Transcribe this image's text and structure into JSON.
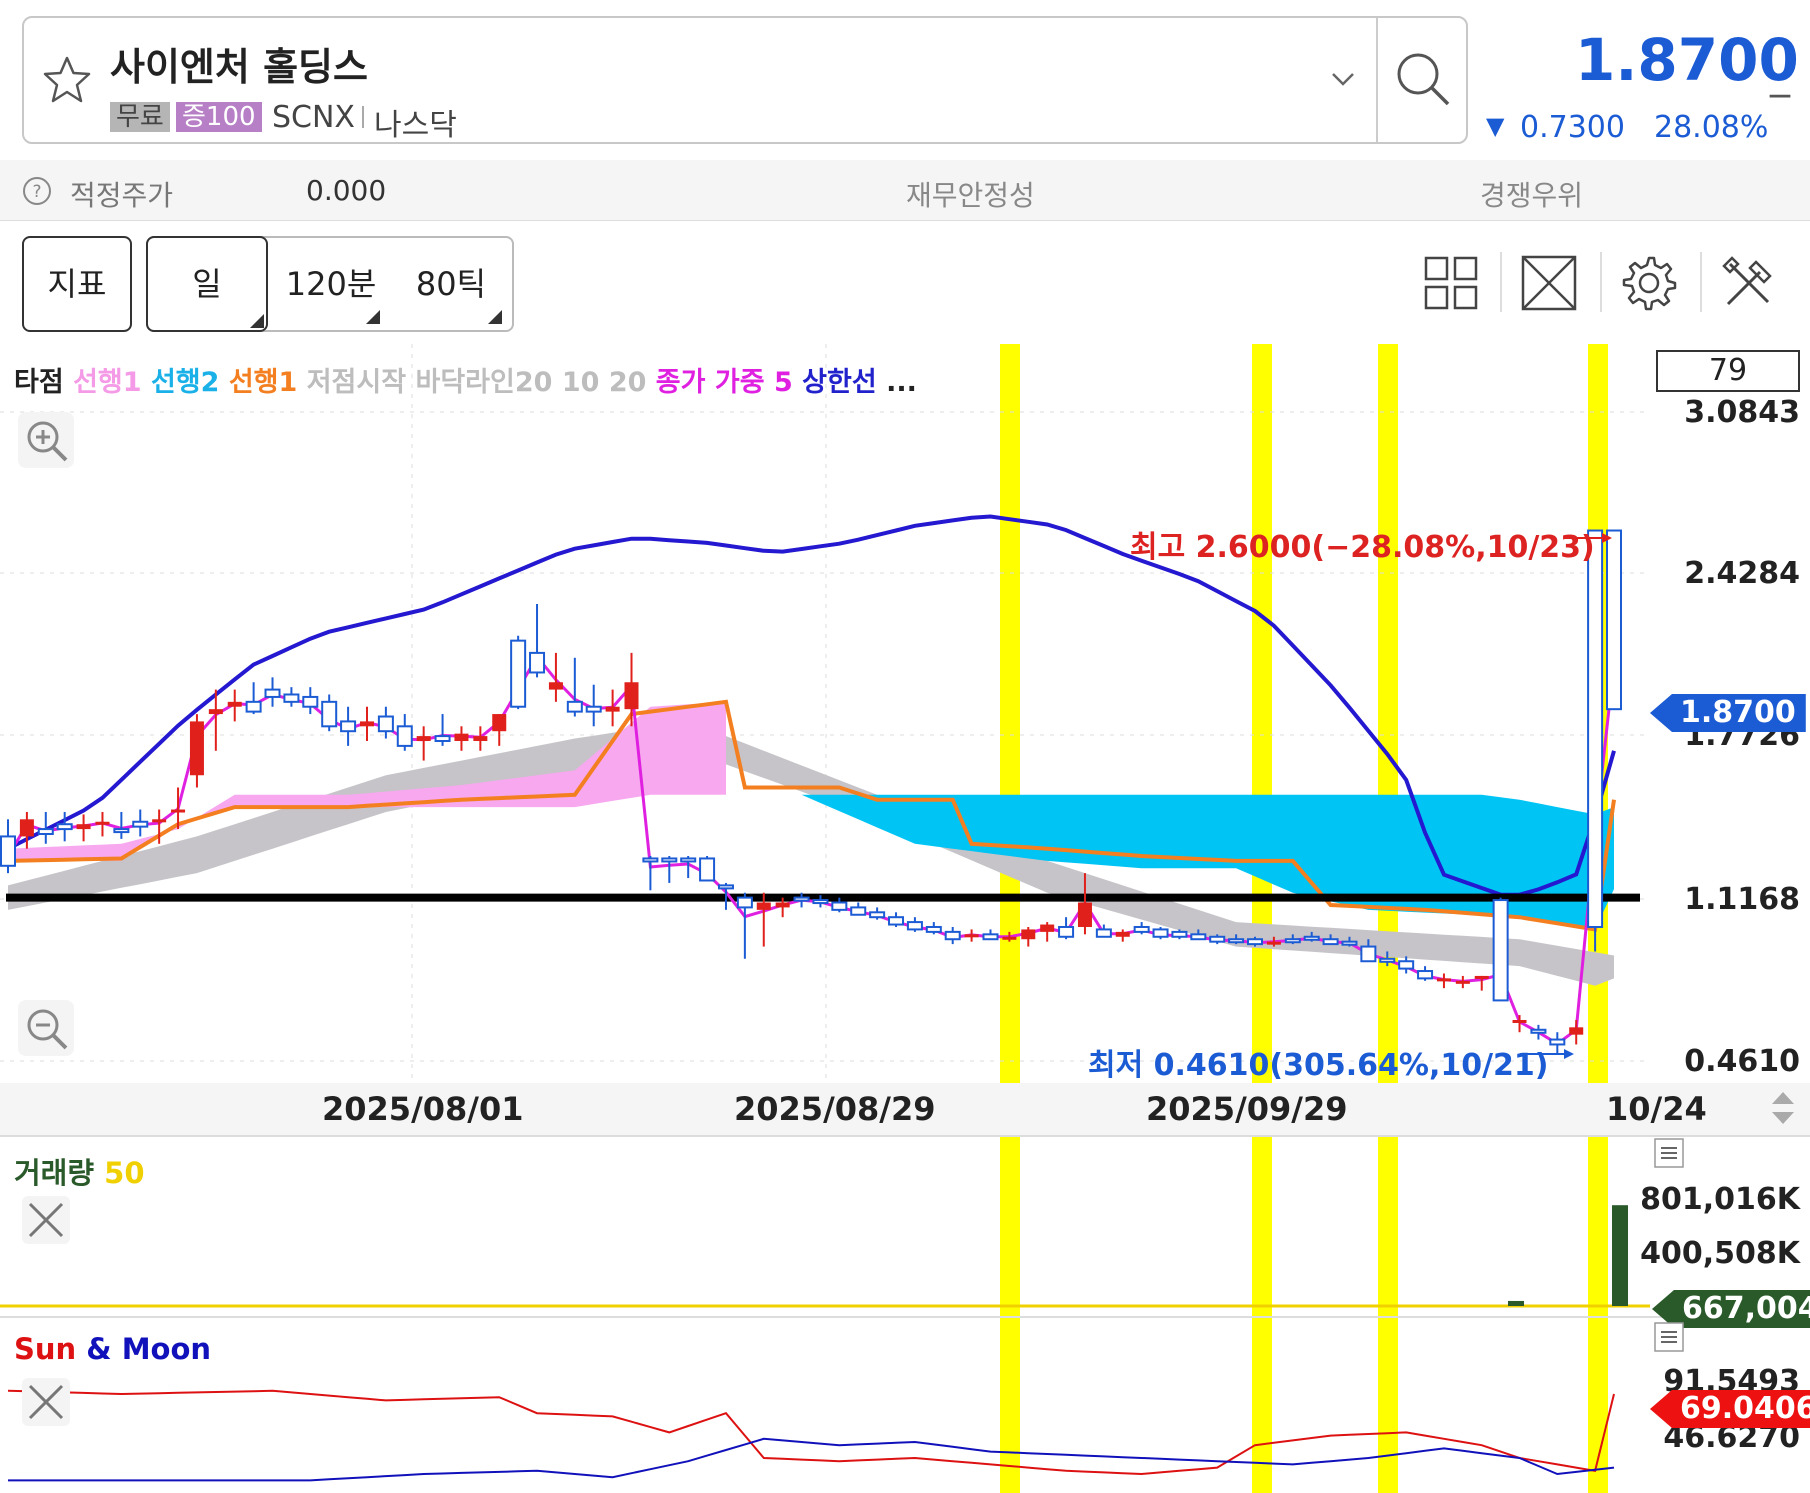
{
  "header": {
    "name": "사이엔처 홀딩스",
    "badge_free": "무료",
    "badge_margin": "증100",
    "ticker": "SCNX",
    "exchange": "나스닥",
    "price": "1.8700",
    "price_suffix": "_",
    "change_arrow": "▼",
    "change": "0.7300",
    "change_pct": "28.08%",
    "price_color": "#1b5bd4"
  },
  "info_row": {
    "fair_price_label": "적정주가",
    "fair_price_value": "0.000",
    "financial_stability_label": "재무안정성",
    "competitive_advantage_label": "경쟁우위"
  },
  "toolbar": {
    "indicator_label": "지표",
    "periods": [
      "일",
      "120분",
      "80틱"
    ],
    "tool_icons": [
      "grid-layout-icon",
      "fullscreen-icon",
      "gear-icon",
      "tools-icon"
    ]
  },
  "legend": {
    "items": [
      {
        "text": "타점",
        "color": "#222222"
      },
      {
        "text": "선행1",
        "color": "#f49ae6"
      },
      {
        "text": "선행2",
        "color": "#1ab0e8"
      },
      {
        "text": "선행1",
        "color": "#f47f20"
      },
      {
        "text": "저점시작",
        "color": "#bdbdbd"
      },
      {
        "text": "바닥라인20",
        "color": "#bdbdbd"
      },
      {
        "text": "10",
        "color": "#bdbdbd"
      },
      {
        "text": "20",
        "color": "#bdbdbd"
      },
      {
        "text": "종가",
        "color": "#e020e0"
      },
      {
        "text": "가중",
        "color": "#e020e0"
      },
      {
        "text": "5",
        "color": "#e020e0"
      },
      {
        "text": "상한선",
        "color": "#2222cc"
      },
      {
        "text": "...",
        "color": "#222222"
      }
    ],
    "period_box": "79"
  },
  "chart_data": [
    {
      "type": "candlestick",
      "title": "",
      "y_axis_ticks": [
        "3.0843",
        "2.4284",
        "1.7726",
        "1.1168",
        "0.4610"
      ],
      "ylim": [
        0.461,
        3.0843
      ],
      "x_axis_ticks": [
        "2025/08/01",
        "2025/08/29",
        "2025/09/29",
        "10/24"
      ],
      "current_price_tag": "1.8700",
      "high_annotation": "최고 2.6000(−28.08%,10/23)",
      "low_annotation": "최저 0.4610(305.64%,10/21)",
      "horizontal_line": 1.1,
      "candles": [
        [
          1.35,
          1.42,
          1.2,
          1.23
        ],
        [
          1.35,
          1.45,
          1.3,
          1.42
        ],
        [
          1.38,
          1.45,
          1.32,
          1.36
        ],
        [
          1.4,
          1.45,
          1.33,
          1.38
        ],
        [
          1.38,
          1.44,
          1.33,
          1.4
        ],
        [
          1.4,
          1.45,
          1.35,
          1.41
        ],
        [
          1.38,
          1.45,
          1.34,
          1.37
        ],
        [
          1.41,
          1.46,
          1.35,
          1.39
        ],
        [
          1.41,
          1.46,
          1.32,
          1.42
        ],
        [
          1.45,
          1.55,
          1.38,
          1.46
        ],
        [
          1.6,
          1.85,
          1.55,
          1.82
        ],
        [
          1.85,
          1.95,
          1.7,
          1.87
        ],
        [
          1.88,
          1.95,
          1.82,
          1.9
        ],
        [
          1.9,
          1.98,
          1.85,
          1.86
        ],
        [
          1.95,
          2.0,
          1.88,
          1.92
        ],
        [
          1.93,
          1.96,
          1.88,
          1.9
        ],
        [
          1.92,
          1.96,
          1.85,
          1.88
        ],
        [
          1.9,
          1.93,
          1.78,
          1.8
        ],
        [
          1.82,
          1.88,
          1.72,
          1.78
        ],
        [
          1.8,
          1.88,
          1.74,
          1.82
        ],
        [
          1.84,
          1.88,
          1.75,
          1.78
        ],
        [
          1.8,
          1.85,
          1.7,
          1.72
        ],
        [
          1.74,
          1.8,
          1.66,
          1.76
        ],
        [
          1.76,
          1.85,
          1.72,
          1.74
        ],
        [
          1.74,
          1.8,
          1.7,
          1.77
        ],
        [
          1.74,
          1.8,
          1.7,
          1.76
        ],
        [
          1.78,
          1.85,
          1.72,
          1.85
        ],
        [
          2.15,
          2.17,
          1.87,
          1.88
        ],
        [
          2.1,
          2.3,
          2.0,
          2.02
        ],
        [
          1.95,
          2.1,
          1.9,
          1.98
        ],
        [
          1.9,
          2.08,
          1.84,
          1.86
        ],
        [
          1.88,
          1.97,
          1.8,
          1.86
        ],
        [
          1.86,
          1.95,
          1.8,
          1.88
        ],
        [
          1.87,
          2.1,
          1.8,
          1.98
        ],
        [
          1.26,
          1.27,
          1.13,
          1.25
        ],
        [
          1.26,
          1.27,
          1.16,
          1.25
        ],
        [
          1.26,
          1.27,
          1.18,
          1.25
        ],
        [
          1.26,
          1.27,
          1.18,
          1.17
        ],
        [
          1.15,
          1.16,
          1.05,
          1.14
        ],
        [
          1.1,
          1.12,
          0.85,
          1.06
        ],
        [
          1.05,
          1.12,
          0.9,
          1.08
        ],
        [
          1.06,
          1.1,
          1.02,
          1.08
        ],
        [
          1.1,
          1.12,
          1.06,
          1.09
        ],
        [
          1.09,
          1.11,
          1.06,
          1.08
        ],
        [
          1.08,
          1.1,
          1.04,
          1.05
        ],
        [
          1.06,
          1.08,
          1.03,
          1.03
        ],
        [
          1.04,
          1.06,
          1.01,
          1.02
        ],
        [
          1.02,
          1.04,
          0.98,
          0.99
        ],
        [
          1.0,
          1.02,
          0.96,
          0.97
        ],
        [
          0.98,
          1.0,
          0.95,
          0.96
        ],
        [
          0.96,
          0.98,
          0.91,
          0.93
        ],
        [
          0.95,
          0.97,
          0.92,
          0.95
        ],
        [
          0.95,
          0.97,
          0.93,
          0.93
        ],
        [
          0.94,
          0.96,
          0.92,
          0.94
        ],
        [
          0.93,
          0.98,
          0.9,
          0.97
        ],
        [
          0.96,
          1.0,
          0.92,
          0.99
        ],
        [
          0.98,
          1.02,
          0.93,
          0.94
        ],
        [
          0.98,
          1.2,
          0.95,
          1.08
        ],
        [
          0.97,
          0.99,
          0.94,
          0.94
        ],
        [
          0.94,
          0.97,
          0.92,
          0.96
        ],
        [
          0.98,
          1.0,
          0.95,
          0.96
        ],
        [
          0.97,
          0.98,
          0.93,
          0.94
        ],
        [
          0.96,
          0.97,
          0.93,
          0.94
        ],
        [
          0.95,
          0.97,
          0.93,
          0.93
        ],
        [
          0.94,
          0.95,
          0.91,
          0.92
        ],
        [
          0.93,
          0.95,
          0.91,
          0.92
        ],
        [
          0.93,
          0.94,
          0.9,
          0.91
        ],
        [
          0.91,
          0.94,
          0.9,
          0.92
        ],
        [
          0.93,
          0.95,
          0.91,
          0.92
        ],
        [
          0.94,
          0.96,
          0.92,
          0.93
        ],
        [
          0.93,
          0.95,
          0.91,
          0.91
        ],
        [
          0.92,
          0.94,
          0.9,
          0.91
        ],
        [
          0.9,
          0.93,
          0.87,
          0.84
        ],
        [
          0.85,
          0.88,
          0.82,
          0.84
        ],
        [
          0.84,
          0.86,
          0.79,
          0.81
        ],
        [
          0.8,
          0.82,
          0.76,
          0.77
        ],
        [
          0.77,
          0.79,
          0.73,
          0.77
        ],
        [
          0.76,
          0.78,
          0.73,
          0.76
        ],
        [
          0.77,
          0.78,
          0.72,
          0.78
        ],
        [
          1.09,
          1.1,
          0.68,
          0.68
        ],
        [
          0.6,
          0.62,
          0.55,
          0.6
        ],
        [
          0.56,
          0.58,
          0.52,
          0.55
        ],
        [
          0.52,
          0.55,
          0.46,
          0.5
        ],
        [
          0.54,
          0.6,
          0.5,
          0.57
        ],
        [
          2.6,
          2.6,
          0.88,
          0.98
        ],
        [
          2.6,
          2.6,
          1.88,
          1.87
        ]
      ]
    },
    {
      "type": "bar",
      "title": "거래량",
      "series": [
        {
          "name": "50",
          "values": []
        }
      ],
      "y_axis_ticks": [
        "801,016K",
        "400,508K"
      ],
      "current_tag": "667,004",
      "bars": [
        0.04,
        0.8
      ]
    },
    {
      "type": "line",
      "title": "Sun & Moon",
      "series": [
        {
          "name": "Sun",
          "color": "#dd1111"
        },
        {
          "name": "Moon",
          "color": "#1111bb"
        }
      ],
      "y_axis_ticks": [
        "91.5493",
        "46.6270"
      ],
      "current_tag": "69.0406"
    }
  ]
}
